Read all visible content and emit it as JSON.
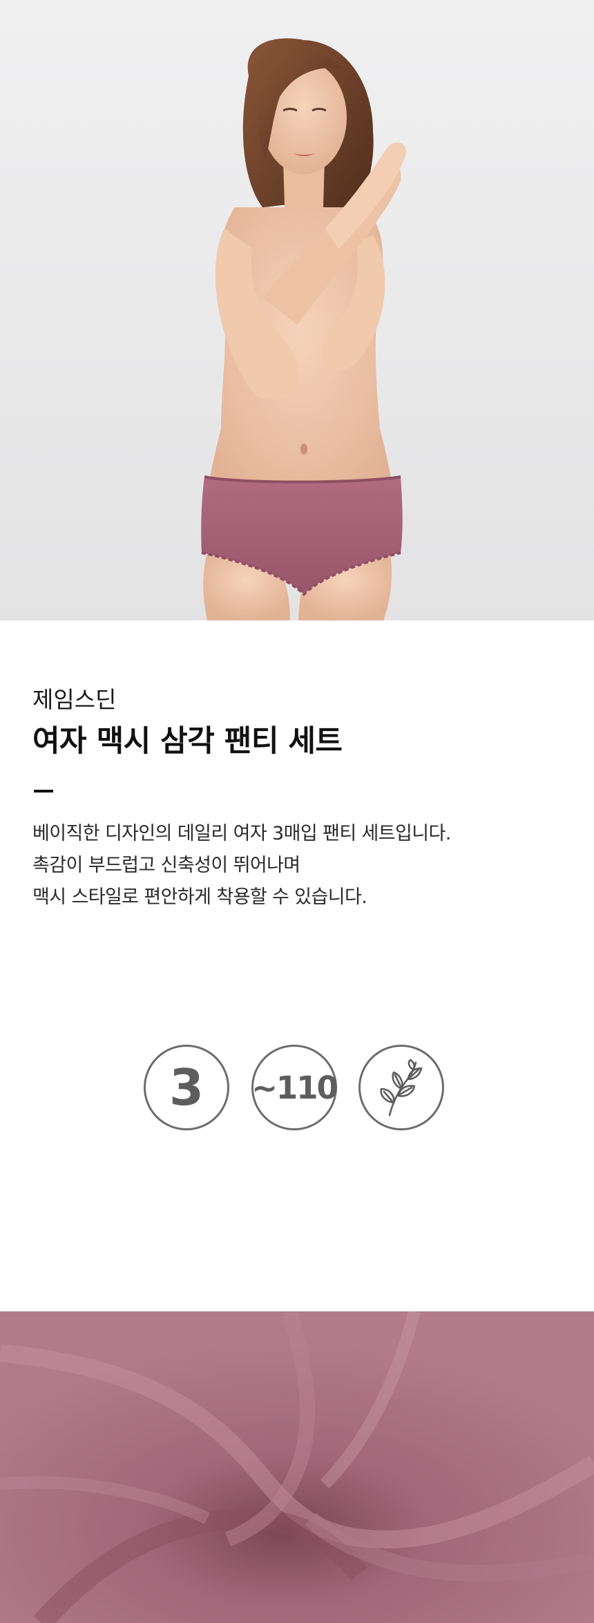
{
  "hero": {
    "image": "model-photo",
    "colors": {
      "background": "#ebebec",
      "garment": "#a65e74",
      "skin": "#efc6aa",
      "hair": "#6b3f28"
    }
  },
  "product": {
    "brand": "제임스딘",
    "title": "여자 맥시 삼각 팬티 세트",
    "description": [
      "베이직한 디자인의 데일리 여자 3매입 팬티 세트입니다.",
      "촉감이 부드럽고 신축성이 뛰어나며",
      "맥시 스타일로 편안하게 착용할 수 있습니다."
    ]
  },
  "features": {
    "count": "3",
    "size": "~110",
    "material_icon": "leaf-branch-icon",
    "badge_color": "#6c6c6c"
  },
  "fabric": {
    "image": "fabric-closeup",
    "color": "#a96b7e"
  }
}
